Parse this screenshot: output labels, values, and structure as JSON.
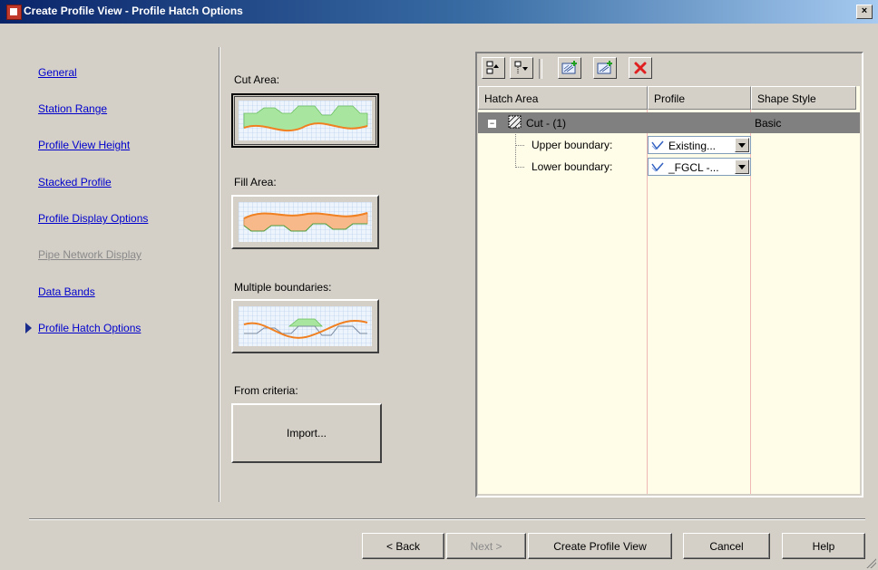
{
  "window": {
    "title": "Create Profile View - Profile Hatch Options",
    "close_label": "×"
  },
  "nav": {
    "items": [
      {
        "label": "General",
        "enabled": true,
        "current": false
      },
      {
        "label": "Station Range",
        "enabled": true,
        "current": false
      },
      {
        "label": "Profile View Height",
        "enabled": true,
        "current": false
      },
      {
        "label": "Stacked Profile",
        "enabled": true,
        "current": false
      },
      {
        "label": "Profile Display Options",
        "enabled": true,
        "current": false
      },
      {
        "label": "Pipe Network Display",
        "enabled": false,
        "current": false
      },
      {
        "label": "Data Bands",
        "enabled": true,
        "current": false
      },
      {
        "label": "Profile Hatch Options",
        "enabled": true,
        "current": true
      }
    ]
  },
  "hatch_types": {
    "cut_label": "Cut Area:",
    "fill_label": "Fill Area:",
    "multiple_label": "Multiple boundaries:",
    "criteria_label": "From criteria:",
    "import_label": "Import..."
  },
  "grid": {
    "columns": [
      "Hatch Area",
      "Profile",
      "Shape Style"
    ],
    "rows": [
      {
        "hatch_area": "Cut - (1)",
        "profile": "",
        "shape_style": "Basic"
      },
      {
        "hatch_area": "Upper boundary:",
        "profile": "Existing...",
        "shape_style": ""
      },
      {
        "hatch_area": "Lower boundary:",
        "profile": "_FGCL -...",
        "shape_style": ""
      }
    ],
    "expander": "−"
  },
  "buttons": {
    "back": "< Back",
    "next": "Next >",
    "create": "Create Profile View",
    "cancel": "Cancel",
    "help": "Help"
  },
  "colors": {
    "title_start": "#0a246a",
    "cut_fill": "#a8e6a0",
    "fill_fill": "#f7b98a",
    "line_orange": "#f08020",
    "grid_bg": "#fffde8",
    "delete_red": "#e02020"
  }
}
